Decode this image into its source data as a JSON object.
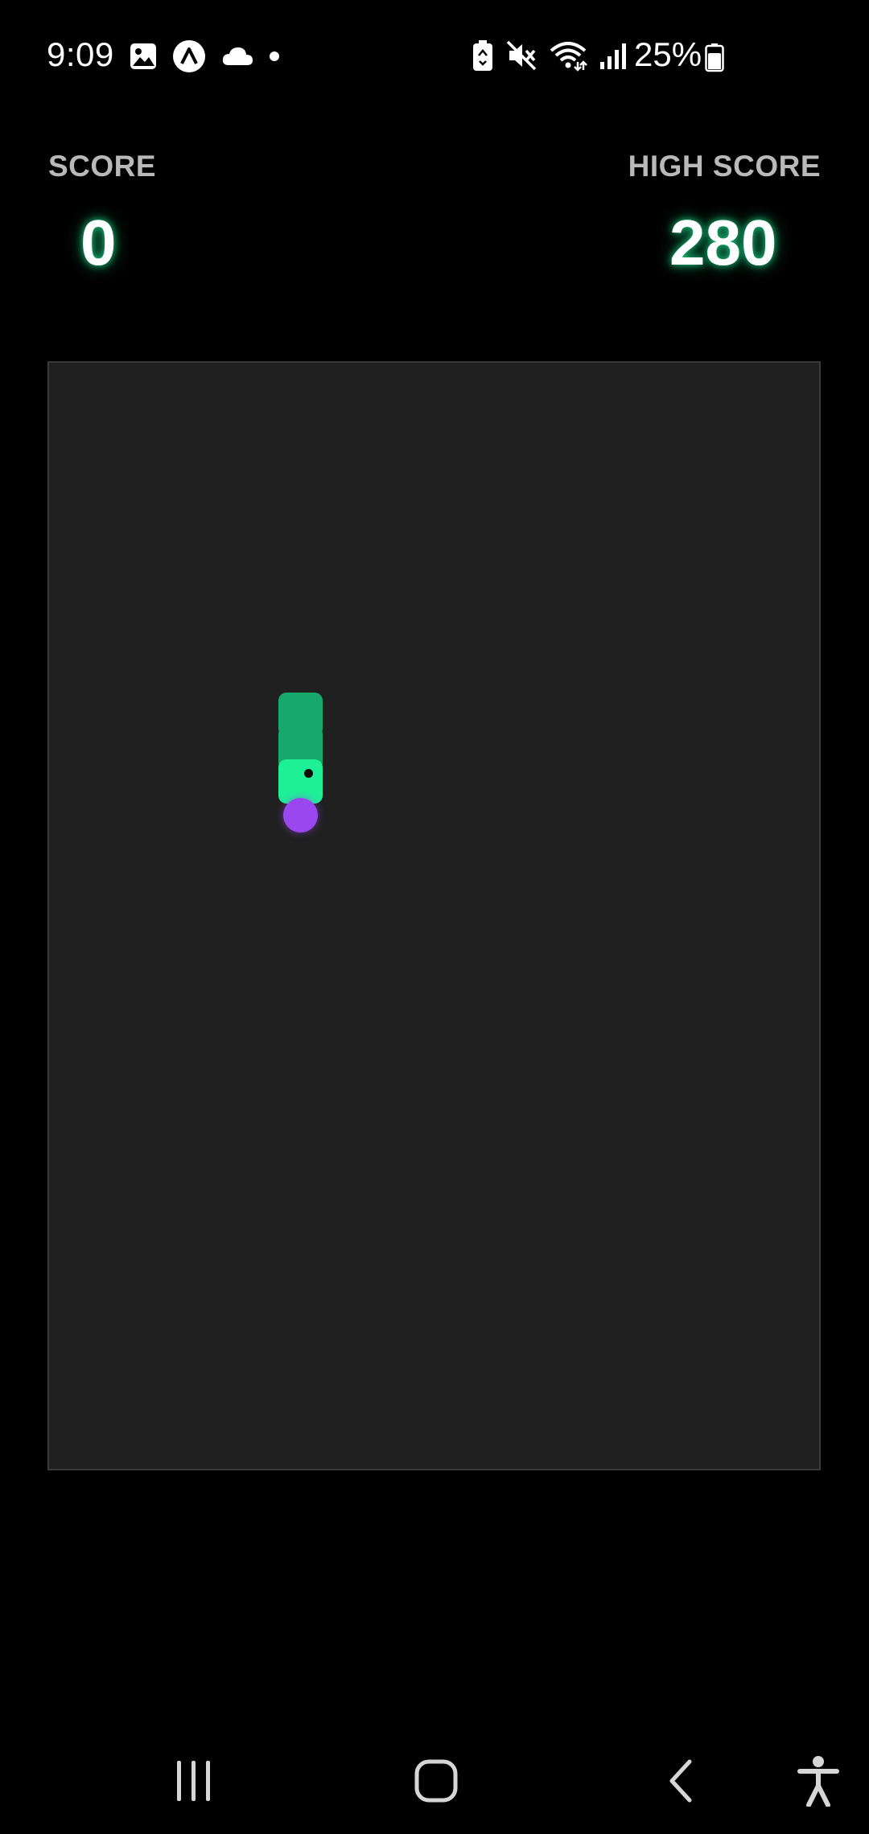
{
  "status_bar": {
    "time": "9:09",
    "battery_percent_text": "25%",
    "battery_level": 0.25,
    "left_icons": [
      "gallery-icon",
      "app-lambda-icon",
      "cloud-icon",
      "dot-icon"
    ],
    "right_icons": [
      "battery-saver-icon",
      "mute-icon",
      "wifi-icon",
      "signal-icon",
      "battery-icon"
    ]
  },
  "header": {
    "score_label": "SCORE",
    "score_value": "0",
    "high_score_label": "HIGH SCORE",
    "high_score_value": "280"
  },
  "board": {
    "grid_columns": 23,
    "grid_rows": 33,
    "snake": [
      {
        "col": 7,
        "row": 10,
        "is_head": false
      },
      {
        "col": 7,
        "row": 11,
        "is_head": false
      },
      {
        "col": 7,
        "row": 12,
        "is_head": true
      }
    ],
    "food": {
      "col": 7,
      "row": 13
    },
    "colors": {
      "background": "#202020",
      "snake_body": "#17a86b",
      "snake_head": "#1ef096",
      "food": "#9a47f0"
    }
  },
  "nav_bar": {
    "buttons": [
      "recents-icon",
      "home-icon",
      "back-icon",
      "accessibility-icon"
    ]
  }
}
